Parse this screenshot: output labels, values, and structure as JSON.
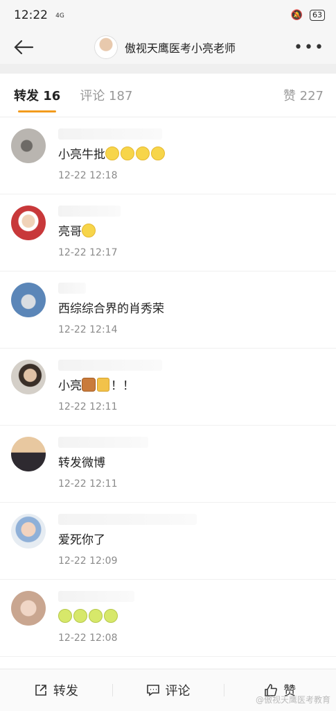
{
  "status_bar": {
    "time": "12:22",
    "network": "4G",
    "battery": "63"
  },
  "header": {
    "title": "傲视天鹰医考小亮老师",
    "back_icon": "back-arrow-icon",
    "more_icon": "more-dots-icon"
  },
  "tabs": [
    {
      "label": "转发 16",
      "active": true
    },
    {
      "label": "评论 187",
      "active": false
    },
    {
      "label": "赞 227",
      "active": false
    }
  ],
  "reposts": [
    {
      "text": "小亮牛批",
      "time": "12-22 12:18",
      "avatar_color": "#8d8a86"
    },
    {
      "text": "亮哥",
      "time": "12-22 12:17",
      "avatar_color": "#c8383a"
    },
    {
      "text": "西综综合界的肖秀荣",
      "time": "12-22 12:14",
      "avatar_color": "#5b86b8"
    },
    {
      "text": "小亮",
      "suffix": "！！",
      "time": "12-22 12:11",
      "avatar_color": "#6b5a4c"
    },
    {
      "text": "转发微博",
      "time": "12-22 12:11",
      "avatar_color": "#4a4550"
    },
    {
      "text": "爱死你了",
      "time": "12-22 12:09",
      "avatar_color": "#b9c4d2"
    },
    {
      "text": "",
      "time": "12-22 12:08",
      "avatar_color": "#d8b8a8"
    }
  ],
  "bottom_bar": {
    "repost": "转发",
    "comment": "评论",
    "like": "赞"
  },
  "watermark": "@傲视天鹰医考教育"
}
